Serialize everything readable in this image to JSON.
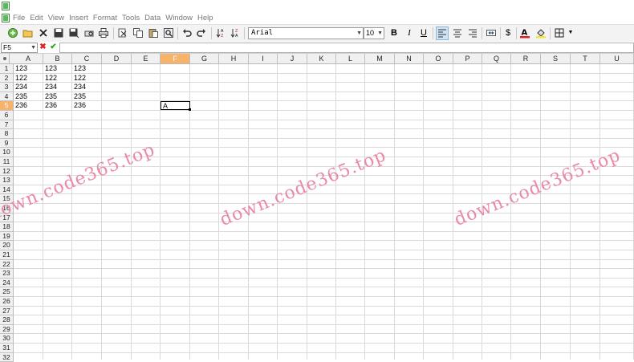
{
  "menu": [
    "File",
    "Edit",
    "View",
    "Insert",
    "Format",
    "Tools",
    "Data",
    "Window",
    "Help"
  ],
  "toolbar": {
    "font_name": "Arial",
    "font_size": "10",
    "bold": "B",
    "italic": "I",
    "underline": "U",
    "currency": "$"
  },
  "formula_bar": {
    "cell_ref": "F5",
    "content": ""
  },
  "sheet": {
    "columns": [
      "A",
      "B",
      "C",
      "D",
      "E",
      "F",
      "G",
      "H",
      "I",
      "J",
      "K",
      "L",
      "M",
      "N",
      "O",
      "P",
      "Q",
      "R",
      "S",
      "T",
      "U"
    ],
    "rows": [
      "1",
      "2",
      "3",
      "4",
      "5",
      "6",
      "7",
      "8",
      "9",
      "10",
      "11",
      "12",
      "13",
      "14",
      "15",
      "16",
      "17",
      "18",
      "19",
      "20",
      "21",
      "22",
      "23",
      "24",
      "25",
      "26",
      "27",
      "28",
      "29",
      "30",
      "31",
      "32"
    ],
    "active_column": "F",
    "active_row": "5",
    "cells": [
      {
        "ref": "A1",
        "value": "123"
      },
      {
        "ref": "B1",
        "value": "123"
      },
      {
        "ref": "C1",
        "value": "123"
      },
      {
        "ref": "A2",
        "value": "122"
      },
      {
        "ref": "B2",
        "value": "122"
      },
      {
        "ref": "C2",
        "value": "122"
      },
      {
        "ref": "A3",
        "value": "234"
      },
      {
        "ref": "B3",
        "value": "234"
      },
      {
        "ref": "C3",
        "value": "234"
      },
      {
        "ref": "A4",
        "value": "235"
      },
      {
        "ref": "B4",
        "value": "235"
      },
      {
        "ref": "C4",
        "value": "235"
      },
      {
        "ref": "A5",
        "value": "236"
      },
      {
        "ref": "B5",
        "value": "236"
      },
      {
        "ref": "C5",
        "value": "236"
      },
      {
        "ref": "F5",
        "value": "A"
      }
    ]
  },
  "watermark": "down.code365.top",
  "colors": {
    "active_header": "#f8b36a",
    "watermark": "#e98aa6",
    "grid_line": "#dadada"
  }
}
